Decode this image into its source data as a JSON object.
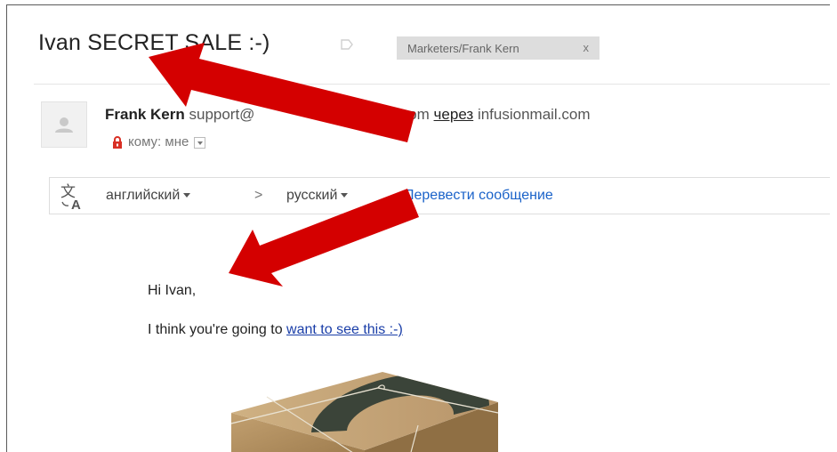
{
  "email": {
    "subject": "Ivan SECRET SALE :-)",
    "label": "Marketers/Frank Kern",
    "label_remove": "x",
    "sender_name": "Frank Kern",
    "sender_email": "support@",
    "sender_domain_partial": "helpdesk.com",
    "via_word": "через",
    "via_domain": "infusionmail.com",
    "to_line": "кому: мне"
  },
  "translate_bar": {
    "source_lang": "английский",
    "arrow": ">",
    "target_lang": "русский",
    "action": "Перевести сообщение"
  },
  "message": {
    "greeting": "Hi Ivan,",
    "line_prefix": "I think you're going to ",
    "link_text": "want to see this :-)"
  },
  "colors": {
    "annotation_arrow": "#d40000",
    "link": "#1a3ea8",
    "translate_link": "#1a62c9",
    "lock": "#d93025"
  },
  "icons": [
    "tag-outline-icon",
    "avatar-placeholder-icon",
    "lock-icon",
    "dropdown-icon",
    "translate-icon"
  ]
}
